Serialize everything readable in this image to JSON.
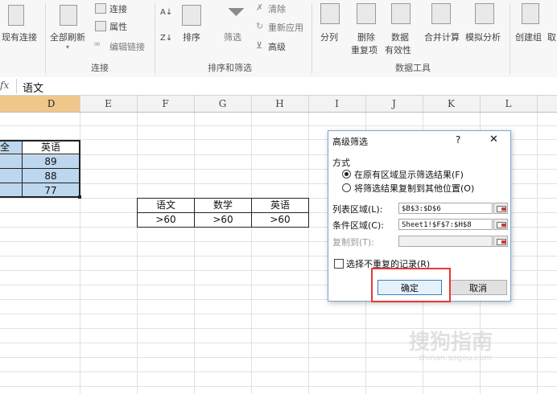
{
  "ribbon": {
    "existing_connections": "现有连接",
    "refresh_all": "全部刷新",
    "connections": "连接",
    "properties": "属性",
    "edit_links": "编辑链接",
    "group_connections": "连接",
    "sort_az_icon": "sort-ascending-icon",
    "sort": "排序",
    "filter": "筛选",
    "clear": "清除",
    "reapply": "重新应用",
    "advanced": "高级",
    "group_sort_filter": "排序和筛选",
    "text_to_columns": "分列",
    "remove_duplicates_1": "删除",
    "remove_duplicates_2": "重复项",
    "data_validation_1": "数据",
    "data_validation_2": "有效性",
    "consolidate": "合并计算",
    "what_if": "模拟分析",
    "group_data_tools": "数据工具",
    "group": "创建组",
    "ungroup_partial": "取"
  },
  "formula_bar": {
    "fx": "fx",
    "content": "语文"
  },
  "columns": [
    "D",
    "E",
    "F",
    "G",
    "H",
    "I",
    "J",
    "K",
    "L"
  ],
  "sheet": {
    "left_header_partial": "全",
    "english_header": "英语",
    "english_values": [
      "89",
      "88",
      "77"
    ],
    "criteria_headers": [
      "语文",
      "数学",
      "英语"
    ],
    "criteria_values": [
      ">60",
      ">60",
      ">60"
    ]
  },
  "dialog": {
    "title": "高级筛选",
    "help": "?",
    "close": "✕",
    "mode_label": "方式",
    "option1": "在原有区域显示筛选结果(F)",
    "option2": "将筛选结果复制到其他位置(O)",
    "list_range_label": "列表区域(L):",
    "list_range_value": "$B$3:$D$6",
    "criteria_range_label": "条件区域(C):",
    "criteria_range_value": "Sheet1!$F$7:$H$8",
    "copy_to_label": "复制到(T):",
    "copy_to_value": "",
    "unique_label": "选择不重复的记录(R)",
    "ok": "确定",
    "cancel": "取消"
  },
  "watermark": {
    "text": "搜狗指南",
    "url": "zhinan.sogou.com"
  }
}
